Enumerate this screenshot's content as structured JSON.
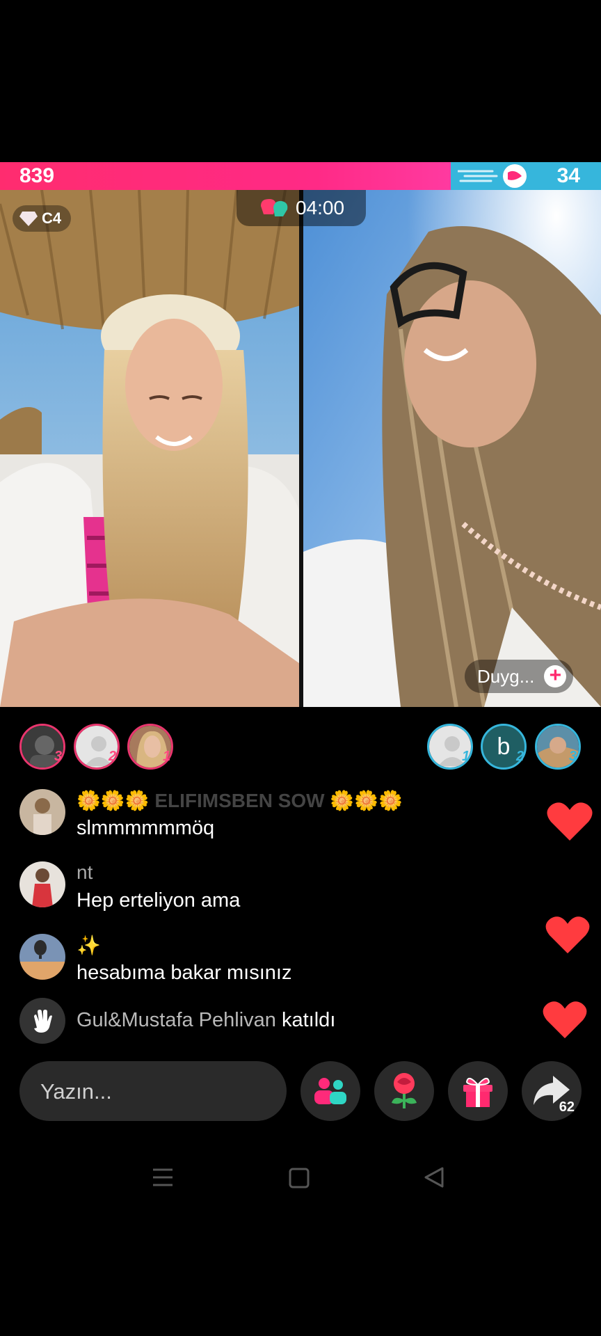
{
  "battle": {
    "left_score": "839",
    "right_score": "34",
    "left_share": 0.75,
    "timer": "04:00",
    "rank_badge": "C4",
    "opponent_name": "Duyg...",
    "colors": {
      "left": "#ff2a7a",
      "right": "#36b6dc"
    }
  },
  "supporters": {
    "left": [
      {
        "rank": "3",
        "initial": ""
      },
      {
        "rank": "2",
        "initial": ""
      },
      {
        "rank": "1",
        "initial": ""
      }
    ],
    "right": [
      {
        "rank": "1",
        "initial": ""
      },
      {
        "rank": "2",
        "initial": "b"
      },
      {
        "rank": "3",
        "initial": ""
      }
    ]
  },
  "comments": [
    {
      "user": "🌼🌼🌼 ELIFIMSBEN SOW 🌼🌼🌼",
      "text": "slmmmmmmöq"
    },
    {
      "user": "nt",
      "text": "Hep erteliyon ama"
    },
    {
      "user": "✨",
      "text": "hesabıma bakar mısınız"
    }
  ],
  "join": {
    "name": "Gul&Mustafa Pehlivan",
    "action": "katıldı"
  },
  "input": {
    "placeholder": "Yazın..."
  },
  "share": {
    "count": "62"
  },
  "icons": [
    "gem-icon",
    "boxing-glove-icon",
    "plus-icon",
    "wave-hand-icon",
    "heart-icon",
    "people-icon",
    "rose-icon",
    "gift-icon",
    "share-arrow-icon",
    "menu-icon",
    "home-square-icon",
    "back-triangle-icon"
  ]
}
